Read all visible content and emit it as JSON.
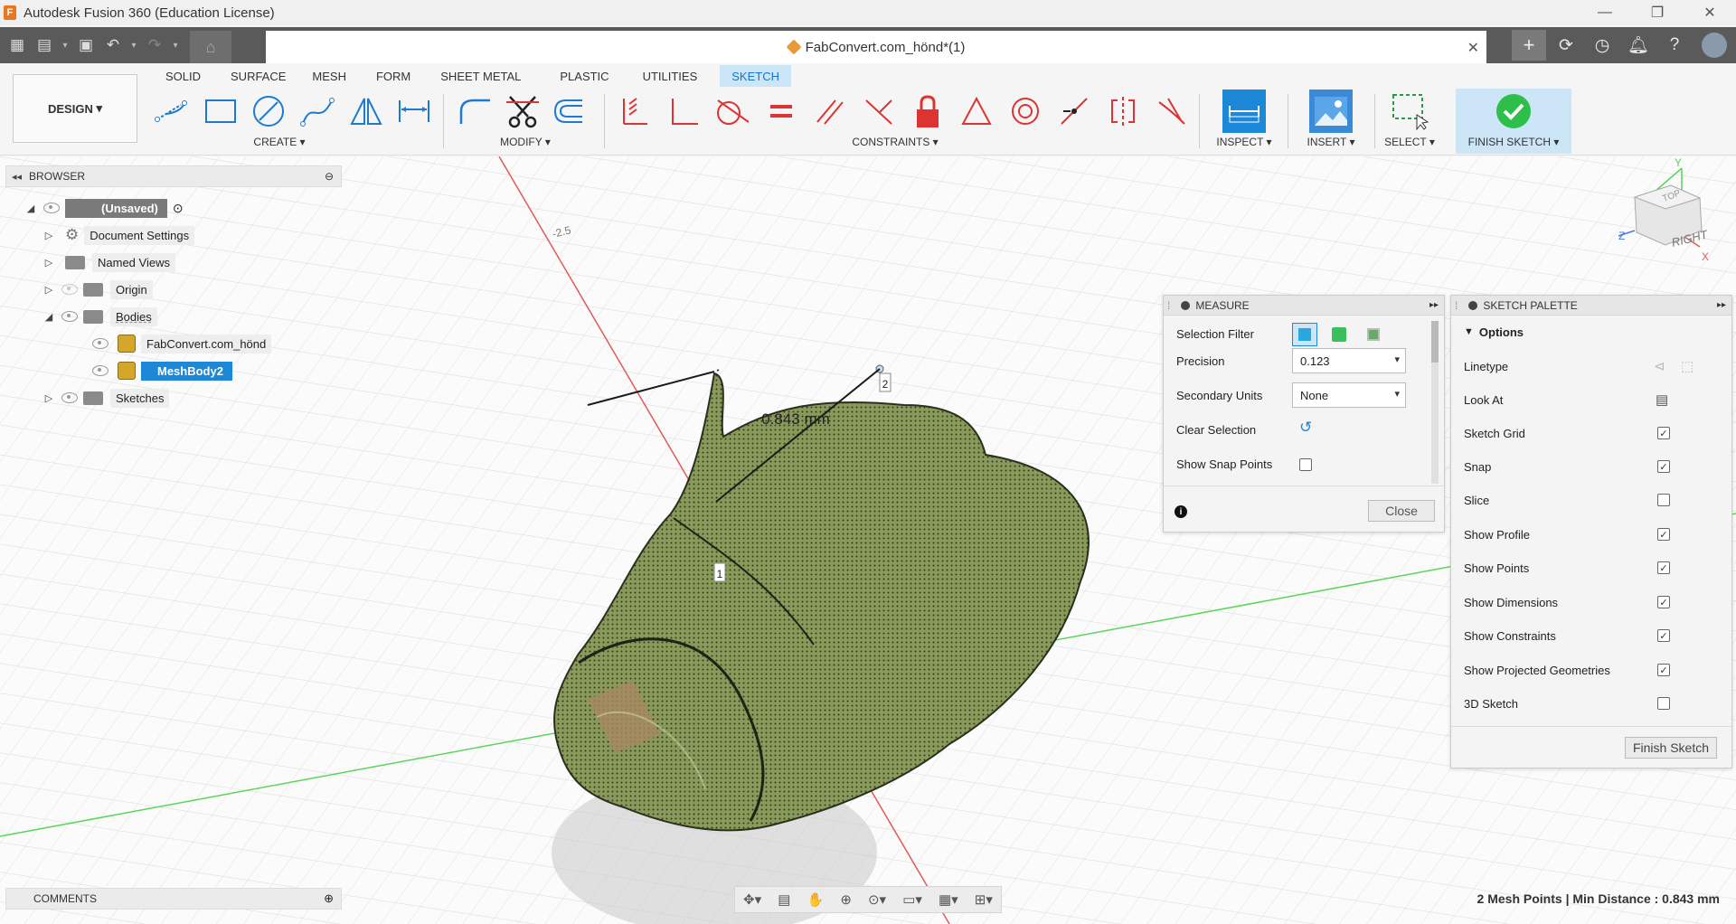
{
  "window": {
    "title": "Autodesk Fusion 360 (Education License)"
  },
  "document_tab": {
    "title": "FabConvert.com_hönd*(1)"
  },
  "ribbon": {
    "workspace": "DESIGN",
    "tabs": [
      "SOLID",
      "SURFACE",
      "MESH",
      "FORM",
      "SHEET METAL",
      "PLASTIC",
      "UTILITIES",
      "SKETCH"
    ],
    "active_tab": "SKETCH",
    "groups": {
      "create": "CREATE",
      "modify": "MODIFY",
      "constraints": "CONSTRAINTS",
      "inspect": "INSPECT",
      "insert": "INSERT",
      "select": "SELECT",
      "finish": "FINISH SKETCH"
    }
  },
  "browser": {
    "title": "BROWSER",
    "items": [
      {
        "label": "(Unsaved)"
      },
      {
        "label": "Document Settings"
      },
      {
        "label": "Named Views"
      },
      {
        "label": "Origin"
      },
      {
        "label": "Bodies"
      },
      {
        "label": "FabConvert.com_hönd"
      },
      {
        "label": "MeshBody2"
      },
      {
        "label": "Sketches"
      }
    ]
  },
  "comments": {
    "title": "COMMENTS"
  },
  "viewport": {
    "axis_label": "-2.5",
    "dimension": "0.843 mm",
    "point1": "1",
    "point2": "2",
    "viewcube_face": "RIGHT",
    "viewcube_top": "TOP"
  },
  "measure": {
    "title": "MEASURE",
    "selection_filter_label": "Selection Filter",
    "precision_label": "Precision",
    "precision_value": "0.123",
    "secondary_units_label": "Secondary Units",
    "secondary_units_value": "None",
    "clear_selection_label": "Clear Selection",
    "show_snap_points_label": "Show Snap Points",
    "close_label": "Close"
  },
  "sketch_palette": {
    "title": "SKETCH PALETTE",
    "section": "Options",
    "rows": [
      {
        "label": "Linetype",
        "type": "icons"
      },
      {
        "label": "Look At",
        "type": "icon"
      },
      {
        "label": "Sketch Grid",
        "checked": true
      },
      {
        "label": "Snap",
        "checked": true
      },
      {
        "label": "Slice",
        "checked": false
      },
      {
        "label": "Show Profile",
        "checked": true
      },
      {
        "label": "Show Points",
        "checked": true
      },
      {
        "label": "Show Dimensions",
        "checked": true
      },
      {
        "label": "Show Constraints",
        "checked": true
      },
      {
        "label": "Show Projected Geometries",
        "checked": true
      },
      {
        "label": "3D Sketch",
        "checked": false
      }
    ],
    "finish_label": "Finish Sketch"
  },
  "status": {
    "text": "2 Mesh Points | Min Distance : 0.843 mm"
  },
  "colors": {
    "accent": "#1e88d8",
    "mesh_green": "#7b8c4e",
    "finish_green": "#2dbf4a"
  }
}
